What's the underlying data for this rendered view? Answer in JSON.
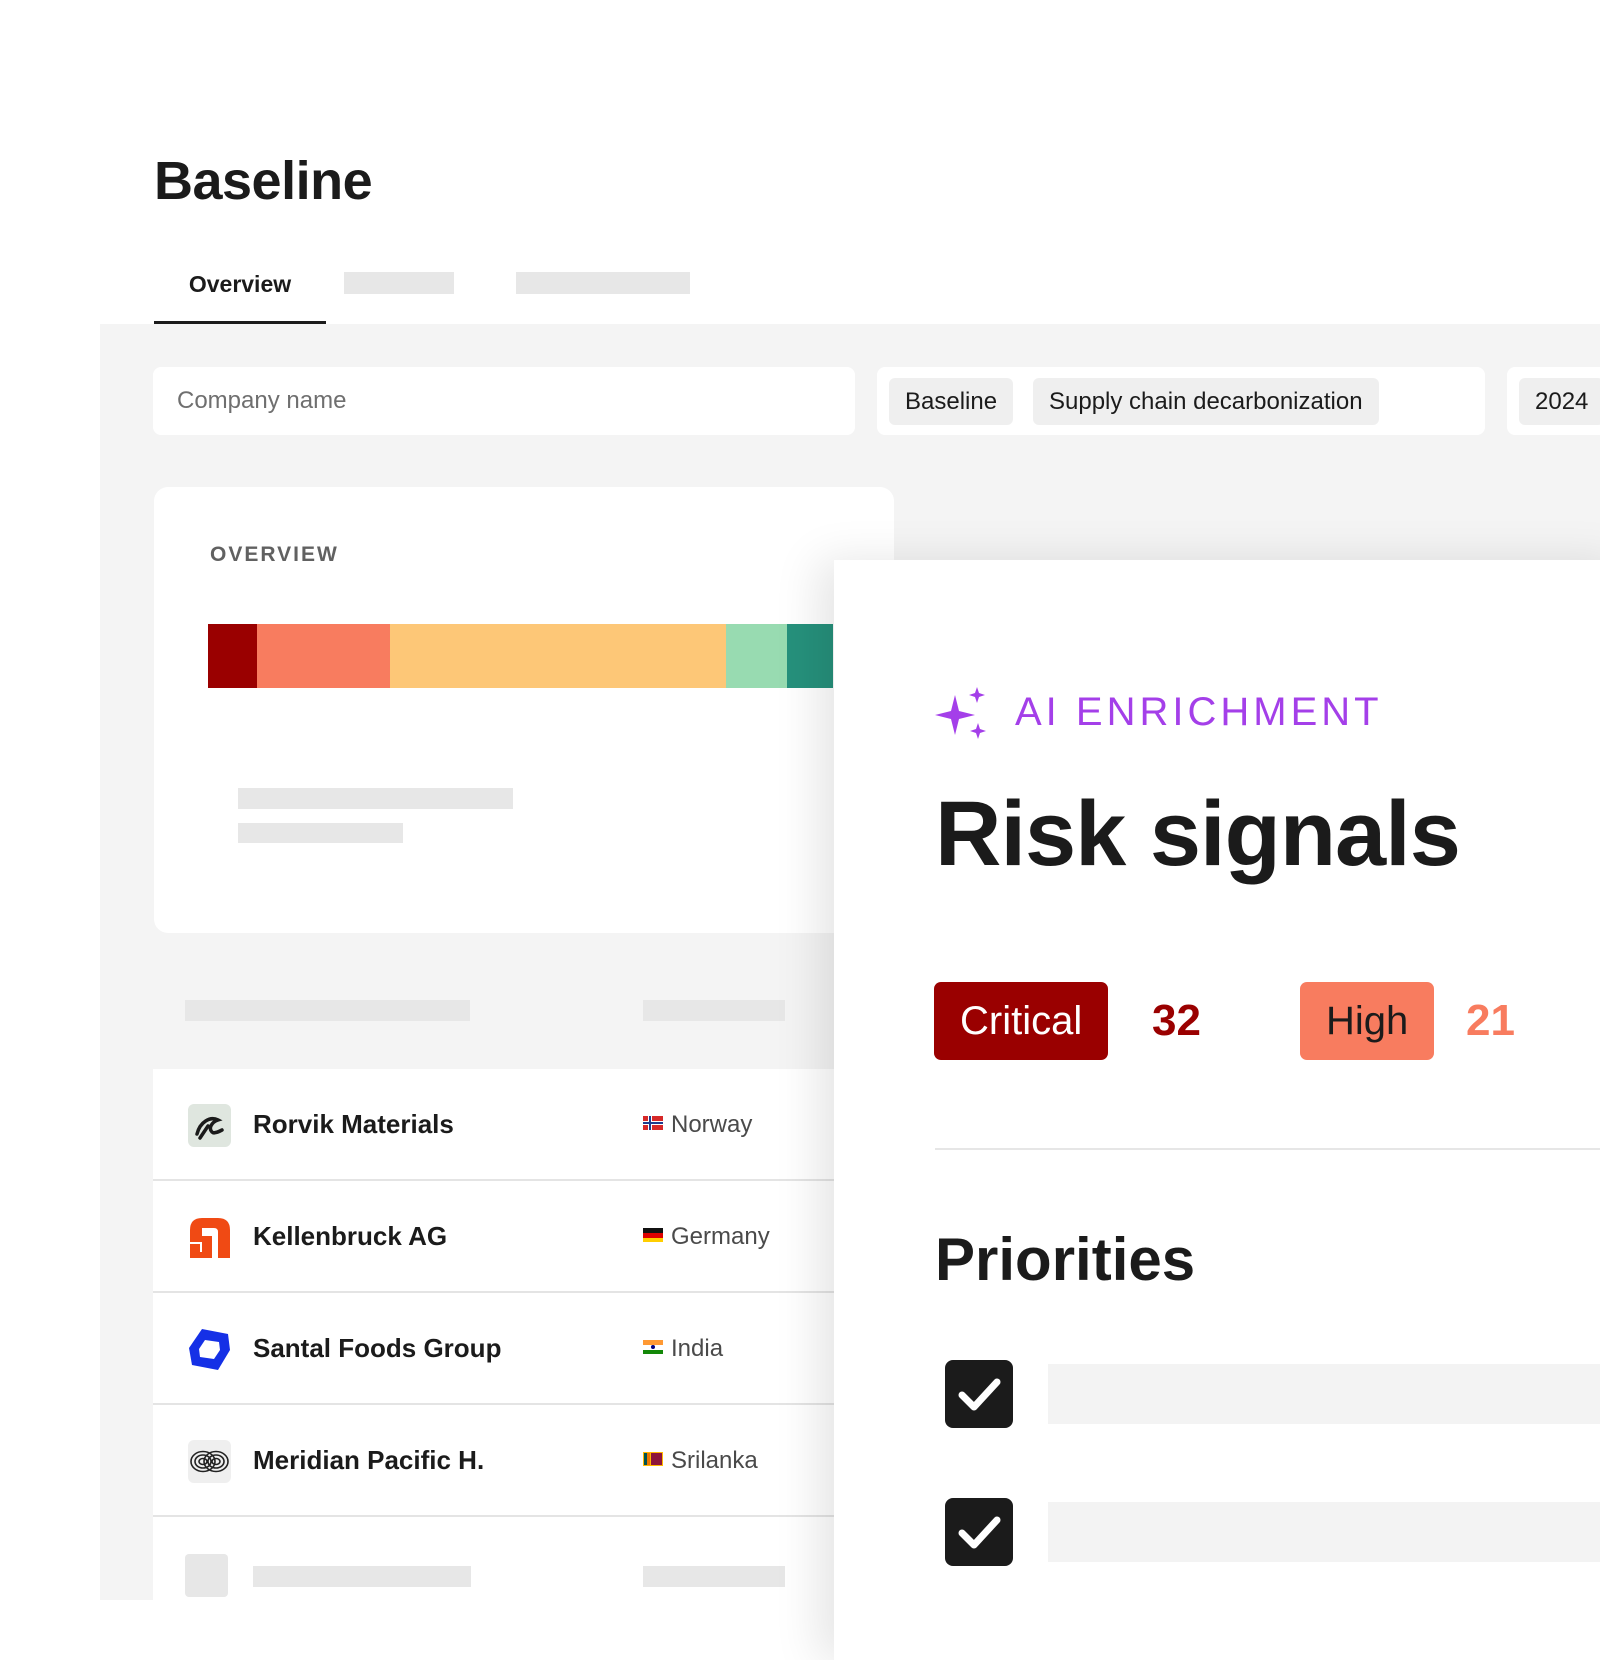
{
  "page": {
    "title": "Baseline"
  },
  "tabs": [
    {
      "label": "Overview",
      "active": true
    }
  ],
  "search": {
    "placeholder": "Company name"
  },
  "filters": {
    "chips": [
      "Baseline",
      "Supply chain decarbonization"
    ],
    "year": "2024"
  },
  "overview": {
    "label": "OVERVIEW",
    "distribution": [
      {
        "color": "#9a0000",
        "share": 0.079
      },
      {
        "color": "#f87c5f",
        "share": 0.213
      },
      {
        "color": "#fdc777",
        "share": 0.537
      },
      {
        "color": "#98dbb1",
        "share": 0.097
      },
      {
        "color": "#26917c",
        "share": 0.074
      }
    ]
  },
  "companies": [
    {
      "name": "Rorvik Materials",
      "country": "Norway",
      "logo_icon": "rorvik-logo-icon",
      "flag_icon": "norway-flag-icon"
    },
    {
      "name": "Kellenbruck AG",
      "country": "Germany",
      "logo_icon": "kellenbruck-logo-icon",
      "flag_icon": "germany-flag-icon"
    },
    {
      "name": "Santal Foods Group",
      "country": "India",
      "logo_icon": "santal-logo-icon",
      "flag_icon": "india-flag-icon"
    },
    {
      "name": "Meridian Pacific H.",
      "country": "Srilanka",
      "logo_icon": "meridian-logo-icon",
      "flag_icon": "srilanka-flag-icon"
    }
  ],
  "panel": {
    "eyebrow": "AI ENRICHMENT",
    "eyebrow_icon": "sparkles-icon",
    "title": "Risk signals",
    "badges": [
      {
        "label": "Critical",
        "count": "32",
        "bg": "#9a0000",
        "fg": "#ffffff",
        "count_color": "#9a0000"
      },
      {
        "label": "High",
        "count": "21",
        "bg": "#f87c5f",
        "fg": "#1b1b1b",
        "count_color": "#f87c5f"
      }
    ],
    "priorities_title": "Priorities",
    "priorities_checked": [
      true,
      true
    ]
  }
}
